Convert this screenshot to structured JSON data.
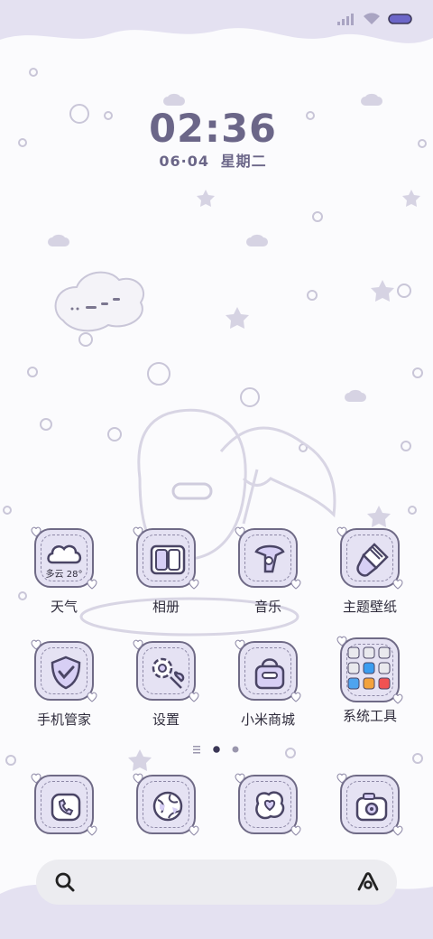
{
  "status_bar": {
    "icons": [
      "signal-icon",
      "wifi-icon",
      "battery-icon"
    ]
  },
  "clock": {
    "time": "02:36",
    "date": "06·04",
    "weekday": "星期二"
  },
  "apps_row1": [
    {
      "label": "天气",
      "icon": "weather-icon",
      "weather": "多云 28°"
    },
    {
      "label": "相册",
      "icon": "gallery-icon"
    },
    {
      "label": "音乐",
      "icon": "music-icon"
    },
    {
      "label": "主题壁纸",
      "icon": "themes-icon"
    }
  ],
  "apps_row2": [
    {
      "label": "手机管家",
      "icon": "security-icon"
    },
    {
      "label": "设置",
      "icon": "settings-icon"
    },
    {
      "label": "小米商城",
      "icon": "shop-icon"
    },
    {
      "label": "系统工具",
      "icon": "tools-folder-icon"
    }
  ],
  "dock": [
    {
      "icon": "phone-icon"
    },
    {
      "icon": "browser-icon"
    },
    {
      "icon": "messages-icon"
    },
    {
      "icon": "camera-icon"
    }
  ],
  "page_indicator": {
    "pages": 2,
    "current": 1
  },
  "search": {
    "left_icon": "search-icon",
    "right_icon": "assistant-icon"
  },
  "colors": {
    "accent": "#6f6a86",
    "tile": "#e5e2f3",
    "wave": "#e4e1f1",
    "background": "#fbfbfd"
  }
}
